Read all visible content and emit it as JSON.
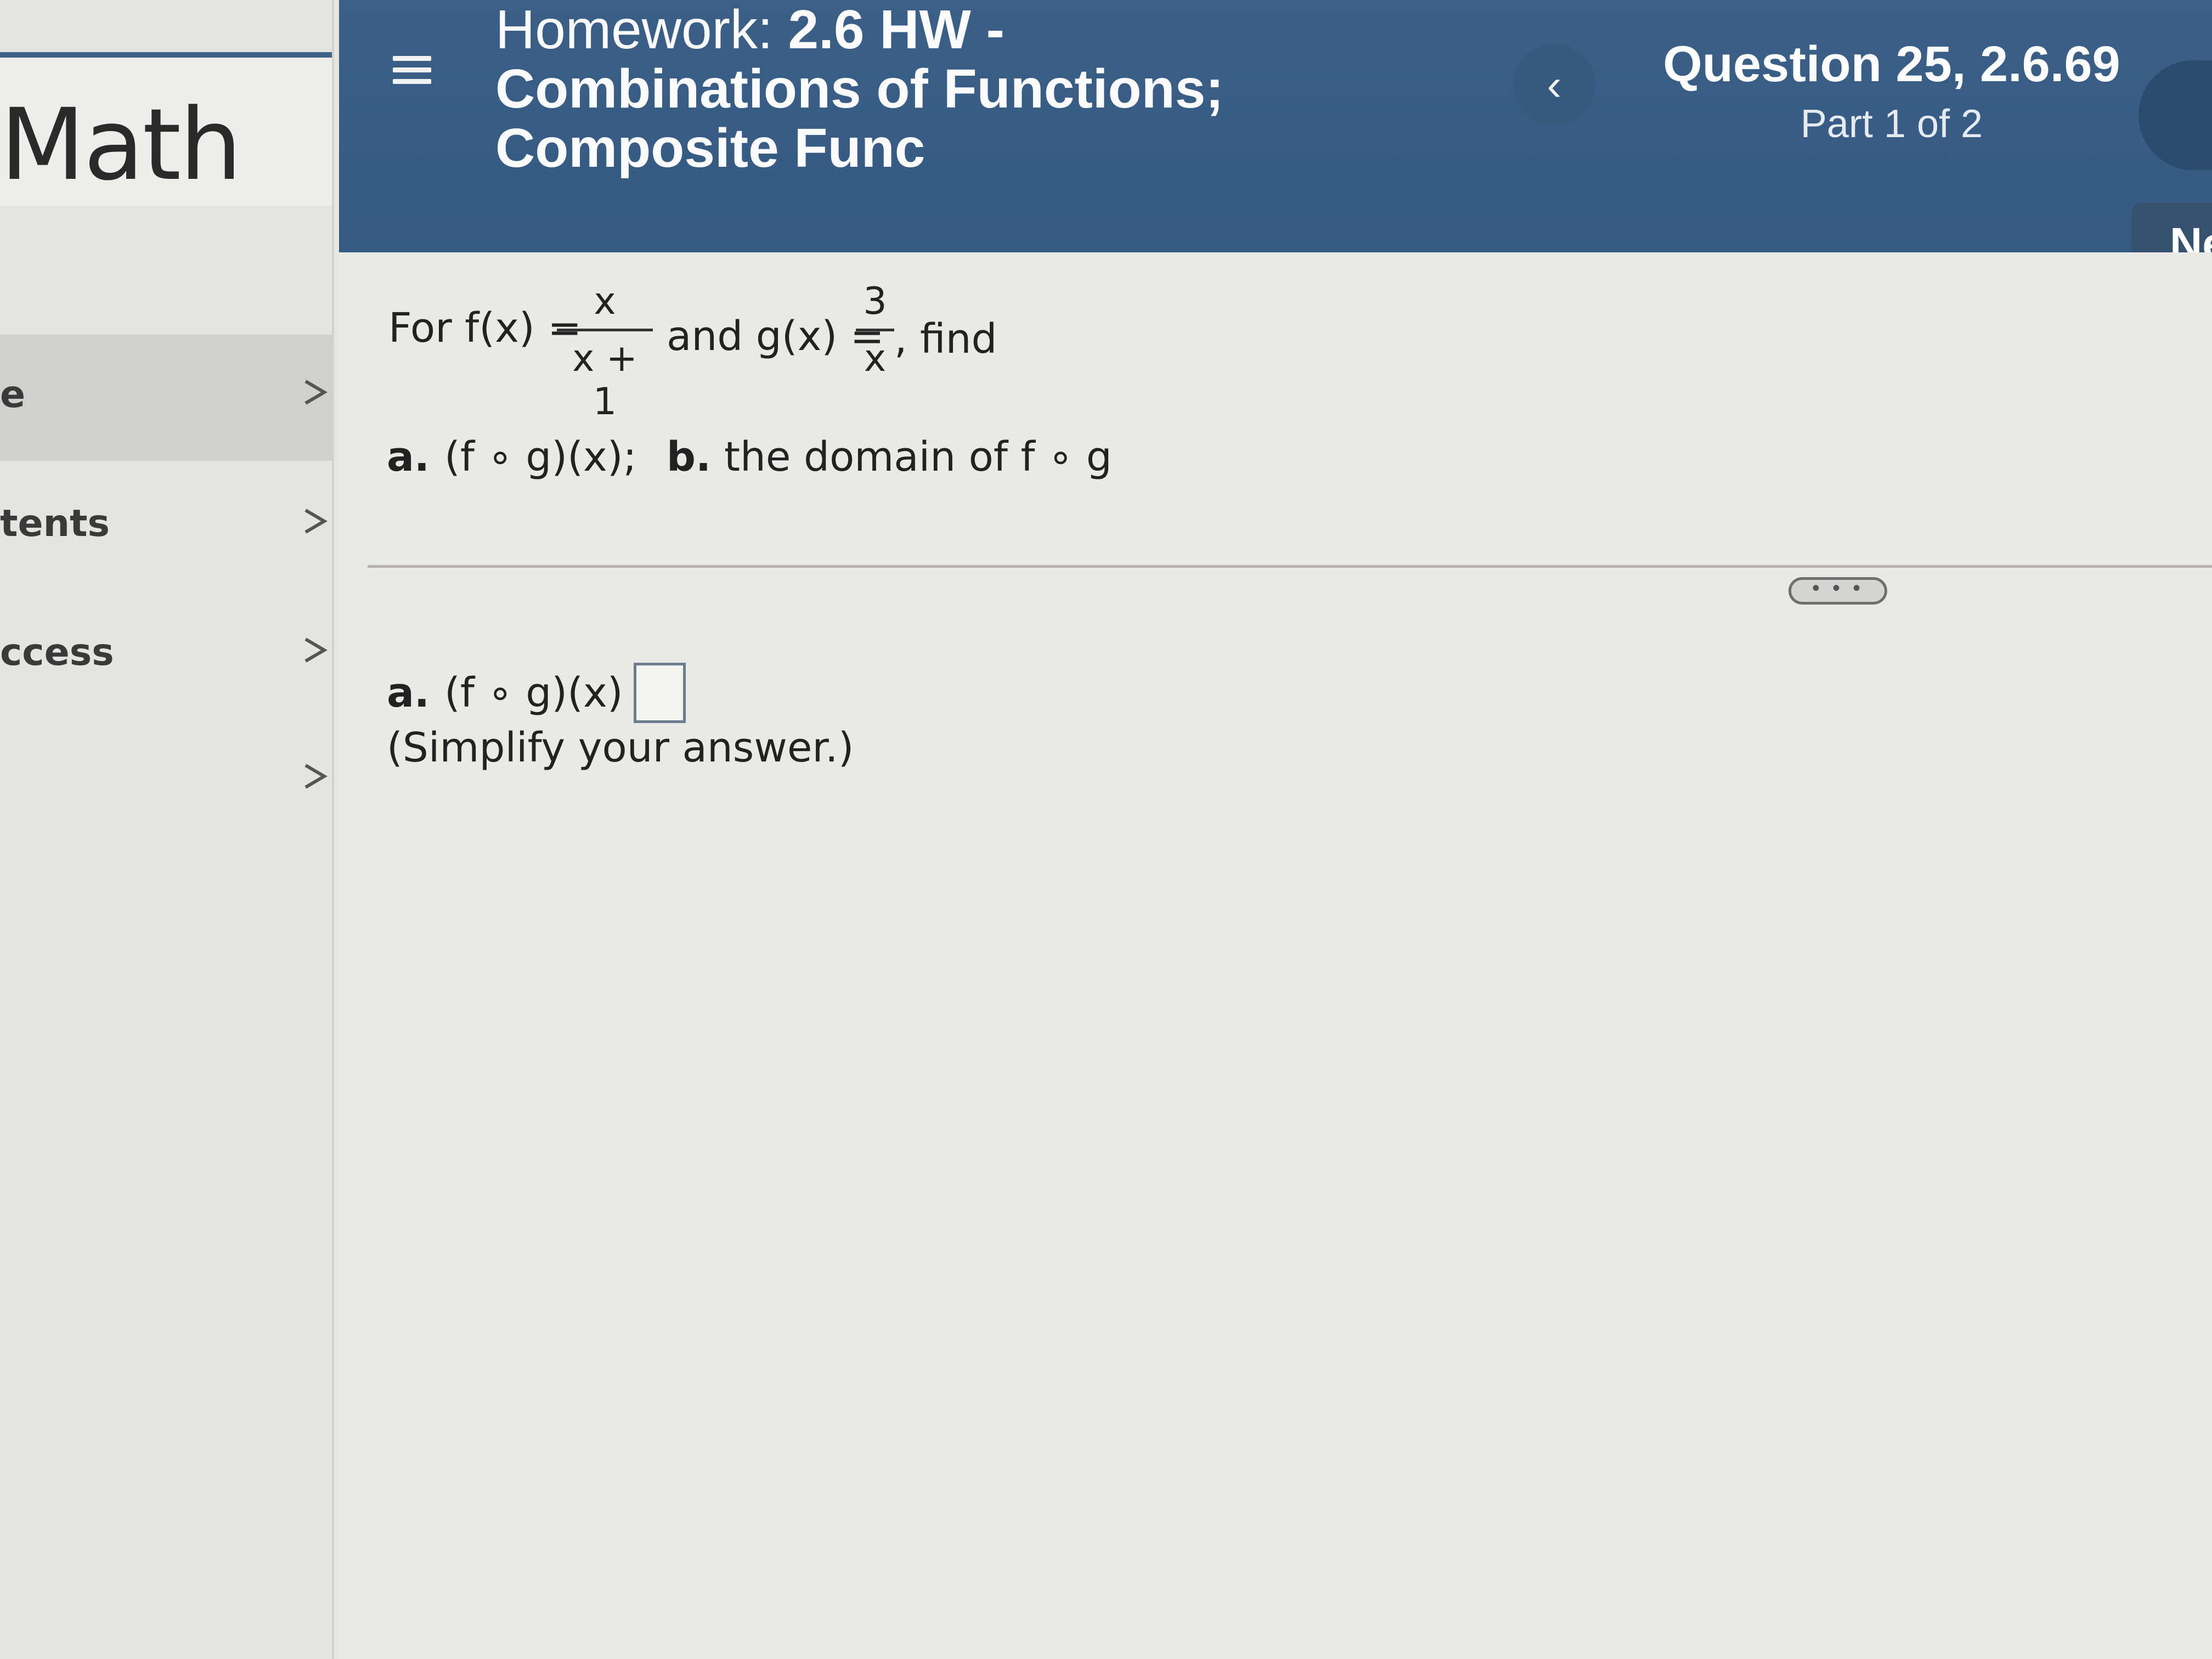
{
  "sidebar": {
    "brand": "Math",
    "items": [
      {
        "label": "e"
      },
      {
        "label": "tents"
      },
      {
        "label": "ccess"
      },
      {
        "label": ""
      }
    ]
  },
  "header": {
    "title_prefix": "Homework: ",
    "title_bold": "2.6 HW - Combinations of Functions; Composite Func",
    "prev_icon": "‹",
    "question_label": "Question 25, 2.6.69",
    "part_label": "Part 1 of 2",
    "next_icon": "›",
    "next_tab_label": "Ne"
  },
  "question": {
    "intro_for": "For f(x) =",
    "f_numerator": "x",
    "f_denominator": "x + 1",
    "intro_and": "and g(x) =",
    "g_numerator": "3",
    "g_denominator": "x",
    "intro_find": ", find",
    "part_a_letter": "a.",
    "part_a_text": "(f ∘ g)(x);",
    "part_b_letter": "b.",
    "part_b_text": "the domain of f ∘ g"
  },
  "answer": {
    "more_label": "• • •",
    "part_a_letter": "a.",
    "part_a_prompt": "(f ∘ g)(x) =",
    "answer_value": "",
    "hint": "(Simplify your answer.)"
  }
}
